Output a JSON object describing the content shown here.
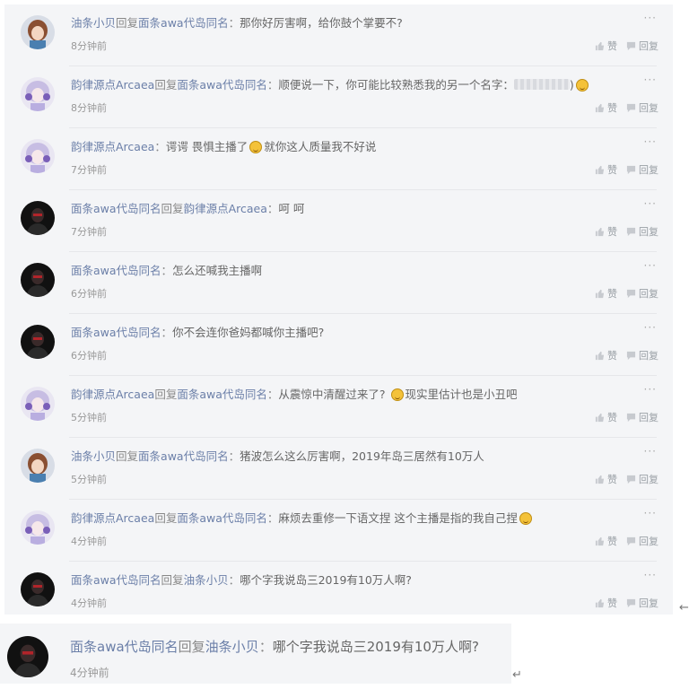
{
  "labels": {
    "like": "赞",
    "reply": "回复",
    "reply_word": "回复",
    "colon": "：",
    "more": "···"
  },
  "comments": [
    {
      "avatar": "girl-brown-hair-avatar",
      "author": "油条小贝",
      "reply_to": "面条awa代岛同名",
      "content": "那你好厉害啊，给你鼓个掌要不?",
      "time": "8分钟前"
    },
    {
      "avatar": "anime-girl-purple-hair-avatar",
      "author": "韵律源点Arcaea",
      "reply_to": "面条awa代岛同名",
      "content": "顺便说一下，你可能比较熟悉我的另一个名字：",
      "content_tail": ")",
      "time": "8分钟前"
    },
    {
      "avatar": "anime-girl-purple-hair-avatar",
      "author": "韵律源点Arcaea",
      "reply_to": "",
      "content": "谔谔 畏惧主播了",
      "content_tail": "就你这人质量我不好说",
      "time": "7分钟前"
    },
    {
      "avatar": "dark-figure-avatar",
      "author": "面条awa代岛同名",
      "reply_to": "韵律源点Arcaea",
      "content": "呵 呵",
      "time": "7分钟前"
    },
    {
      "avatar": "dark-figure-avatar",
      "author": "面条awa代岛同名",
      "reply_to": "",
      "content": "怎么还喊我主播啊",
      "time": "6分钟前"
    },
    {
      "avatar": "dark-figure-avatar",
      "author": "面条awa代岛同名",
      "reply_to": "",
      "content": "你不会连你爸妈都喊你主播吧?",
      "time": "6分钟前"
    },
    {
      "avatar": "anime-girl-purple-hair-avatar",
      "author": "韵律源点Arcaea",
      "reply_to": "面条awa代岛同名",
      "content": "从震惊中清醒过来了?",
      "content_tail": "现实里估计也是小丑吧",
      "time": "5分钟前"
    },
    {
      "avatar": "girl-brown-hair-avatar",
      "author": "油条小贝",
      "reply_to": "面条awa代岛同名",
      "content": "猪波怎么这么厉害啊，2019年岛三居然有10万人",
      "time": "5分钟前"
    },
    {
      "avatar": "anime-girl-purple-hair-avatar",
      "author": "韵律源点Arcaea",
      "reply_to": "面条awa代岛同名",
      "content": "麻烦去重修一下语文捏 这个主播是指的我自己捏",
      "time": "4分钟前"
    },
    {
      "avatar": "dark-figure-avatar",
      "author": "面条awa代岛同名",
      "reply_to": "油条小贝",
      "content": "哪个字我说岛三2019有10万人啊?",
      "time": "4分钟前"
    }
  ],
  "zoomed": {
    "avatar": "dark-figure-avatar",
    "author": "面条awa代岛同名",
    "reply_to": "油条小贝",
    "content": "哪个字我说岛三2019有10万人啊?",
    "time": "4分钟前"
  },
  "return_marks": {
    "first": "←",
    "second": "↵"
  }
}
